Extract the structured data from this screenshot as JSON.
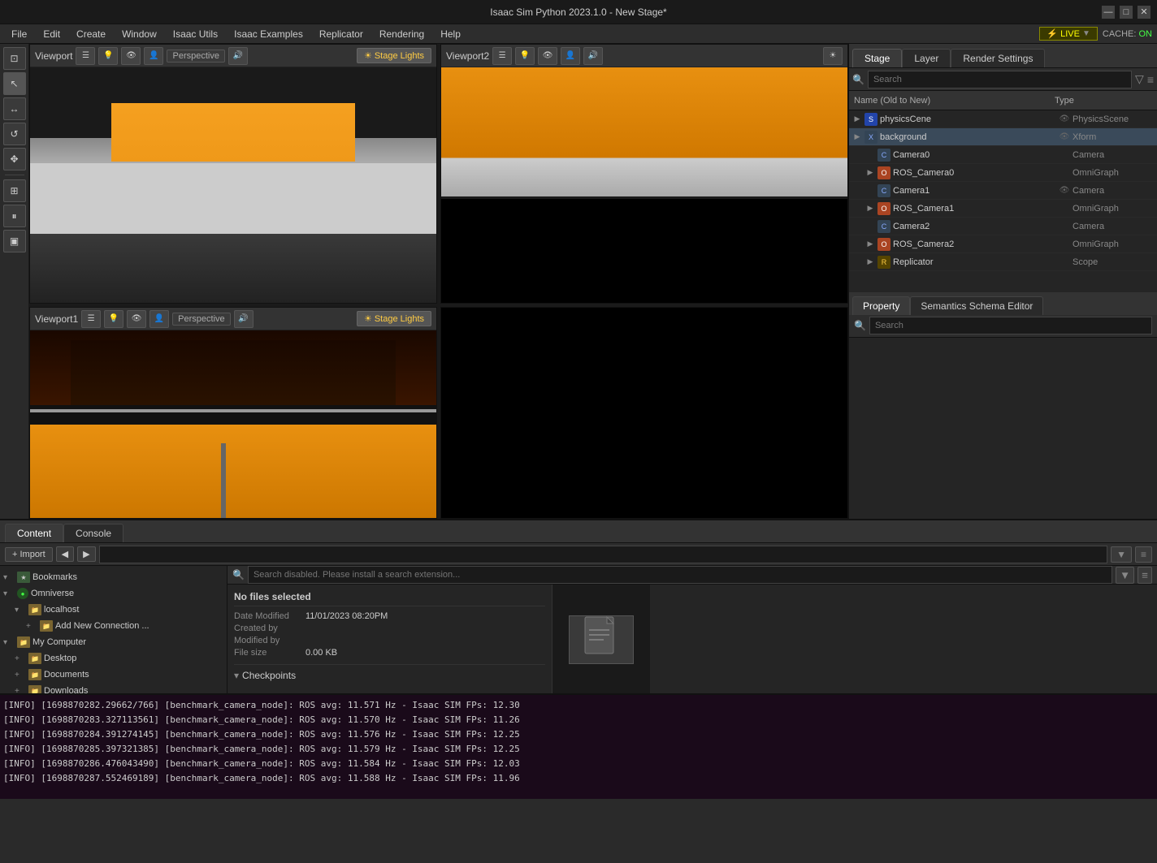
{
  "titlebar": {
    "title": "Isaac Sim Python 2023.1.0 - New Stage*",
    "minimize": "—",
    "maximize": "□",
    "close": "✕"
  },
  "menubar": {
    "items": [
      "File",
      "Edit",
      "Create",
      "Window",
      "Isaac Utils",
      "Isaac Examples",
      "Replicator",
      "Rendering",
      "Help"
    ]
  },
  "status": {
    "live": "LIVE",
    "live_icon": "⚡",
    "cache_label": "CACHE:",
    "cache_value": "ON"
  },
  "left_toolbar": {
    "buttons": [
      "⊡",
      "↖",
      "↔",
      "↺",
      "✥",
      "⊞",
      "▣"
    ]
  },
  "viewport1_header": {
    "title": "Viewport",
    "renderer_label": "Renderer",
    "perspective_label": "Perspective",
    "stage_lights_label": "Stage Lights"
  },
  "viewport1_header_bottom": {
    "title": "Viewport1",
    "renderer_label": "Renderer",
    "perspective_label": "Perspective",
    "stage_lights_label": "Stage Lights"
  },
  "viewport2_header": {
    "title": "Viewport2"
  },
  "stage": {
    "tabs": [
      "Stage",
      "Layer",
      "Render Settings"
    ],
    "search_placeholder": "Search",
    "filter_icon": "▼",
    "columns": {
      "name": "Name (Old to New)",
      "type": "Type"
    },
    "items": [
      {
        "indent": 0,
        "expand": "▶",
        "icon": "S",
        "icon_class": "icon-scene",
        "name": "physicsCene",
        "has_eye": true,
        "type": "PhysicsScene"
      },
      {
        "indent": 0,
        "expand": "▶",
        "icon": "X",
        "icon_class": "icon-xform",
        "name": "background",
        "has_eye": true,
        "type": "Xform"
      },
      {
        "indent": 1,
        "expand": " ",
        "icon": "C",
        "icon_class": "icon-camera",
        "name": "Camera0",
        "has_eye": false,
        "type": "Camera"
      },
      {
        "indent": 1,
        "expand": "▶",
        "icon": "O",
        "icon_class": "icon-omni",
        "name": "ROS_Camera0",
        "has_eye": false,
        "type": "OmniGraph"
      },
      {
        "indent": 1,
        "expand": " ",
        "icon": "C",
        "icon_class": "icon-camera",
        "name": "Camera1",
        "has_eye": true,
        "type": "Camera"
      },
      {
        "indent": 1,
        "expand": "▶",
        "icon": "O",
        "icon_class": "icon-omni",
        "name": "ROS_Camera1",
        "has_eye": false,
        "type": "OmniGraph"
      },
      {
        "indent": 1,
        "expand": " ",
        "icon": "C",
        "icon_class": "icon-camera",
        "name": "Camera2",
        "has_eye": false,
        "type": "Camera"
      },
      {
        "indent": 1,
        "expand": "▶",
        "icon": "O",
        "icon_class": "icon-omni",
        "name": "ROS_Camera2",
        "has_eye": false,
        "type": "OmniGraph"
      },
      {
        "indent": 1,
        "expand": "▶",
        "icon": "R",
        "icon_class": "icon-replicator",
        "name": "Replicator",
        "has_eye": false,
        "type": "Scope"
      }
    ]
  },
  "property": {
    "tabs": [
      "Property",
      "Semantics Schema Editor"
    ],
    "search_placeholder": "Search"
  },
  "content": {
    "tabs": [
      "Content",
      "Console"
    ],
    "import_label": "Import",
    "nav_back": "◀",
    "nav_forward": "▶",
    "search_placeholder": "Search disabled. Please install a search extension...",
    "filter_icon": "▼",
    "menu_icon": "≡"
  },
  "file_tree": {
    "items": [
      {
        "indent": 0,
        "expand": "▾",
        "icon_type": "bookmark",
        "name": "Bookmarks"
      },
      {
        "indent": 0,
        "expand": "▾",
        "icon_type": "omni",
        "name": "Omniverse"
      },
      {
        "indent": 1,
        "expand": "▾",
        "icon_type": "folder",
        "name": "localhost"
      },
      {
        "indent": 2,
        "expand": "+",
        "icon_type": "folder",
        "name": "Add New Connection ..."
      },
      {
        "indent": 0,
        "expand": "▾",
        "icon_type": "folder",
        "name": "My Computer"
      },
      {
        "indent": 1,
        "expand": "+",
        "icon_type": "folder",
        "name": "Desktop"
      },
      {
        "indent": 1,
        "expand": "+",
        "icon_type": "folder",
        "name": "Documents"
      },
      {
        "indent": 1,
        "expand": "+",
        "icon_type": "folder",
        "name": "Downloads"
      },
      {
        "indent": 1,
        "expand": "+",
        "icon_type": "folder",
        "name": "Pictures"
      }
    ]
  },
  "file_detail": {
    "no_files_selected": "No files selected",
    "date_modified_label": "Date Modified",
    "date_modified_value": "11/01/2023 08:20PM",
    "created_by_label": "Created by",
    "created_by_value": "",
    "modified_by_label": "Modified by",
    "modified_by_value": "",
    "file_size_label": "File size",
    "file_size_value": "0.00 KB",
    "checkpoints_label": "Checkpoints",
    "selected_label": "selected"
  },
  "log": {
    "lines": [
      "[INFO] [1698870282.29662/766] [benchmark_camera_node]: ROS avg: 11.571 Hz - Isaac SIM FPs: 12.30",
      "[INFO] [1698870283.327113561] [benchmark_camera_node]: ROS avg: 11.570 Hz - Isaac SIM FPs: 11.26",
      "[INFO] [1698870284.391274145] [benchmark_camera_node]: ROS avg: 11.576 Hz - Isaac SIM FPs: 12.25",
      "[INFO] [1698870285.397321385] [benchmark_camera_node]: ROS avg: 11.579 Hz - Isaac SIM FPs: 12.25",
      "[INFO] [1698870286.476043490] [benchmark_camera_node]: ROS avg: 11.584 Hz - Isaac SIM FPs: 12.03",
      "[INFO] [1698870287.552469189] [benchmark_camera_node]: ROS avg: 11.588 Hz - Isaac SIM FPs: 11.96"
    ]
  }
}
